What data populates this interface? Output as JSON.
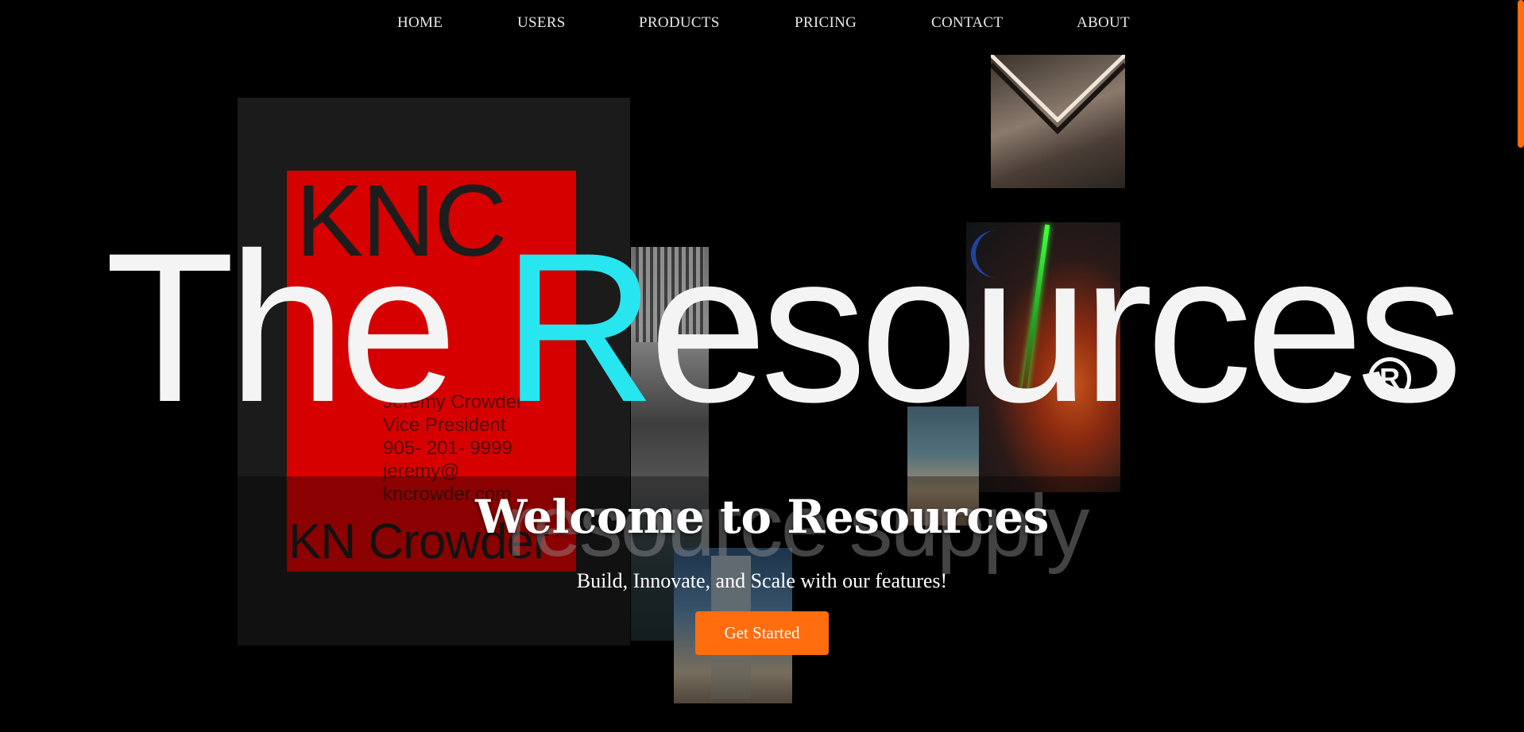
{
  "nav": {
    "items": [
      {
        "label": "HOME"
      },
      {
        "label": "USERS"
      },
      {
        "label": "PRODUCTS"
      },
      {
        "label": "PRICING"
      },
      {
        "label": "CONTACT"
      },
      {
        "label": "ABOUT"
      }
    ]
  },
  "collage": {
    "card_brand": "KNC",
    "card_details": "Jeremy Crowder\nVice President\n905- 201- 9999\njeremy@\nkncrowder.com",
    "card_footer": "KN Crowder",
    "title_text_part1": "The ",
    "title_text_cyan": "R",
    "title_text_part2": "esources",
    "registered_mark": "R",
    "ghost_subtitle": "resource supply"
  },
  "hero": {
    "title": "Welcome to Resources",
    "subtitle": "Build, Innovate, and Scale with our features!",
    "cta_label": "Get Started"
  },
  "colors": {
    "accent": "#ff6d0f",
    "background": "#000000",
    "title_cyan": "#28e6f0",
    "card_red": "#d60000"
  }
}
